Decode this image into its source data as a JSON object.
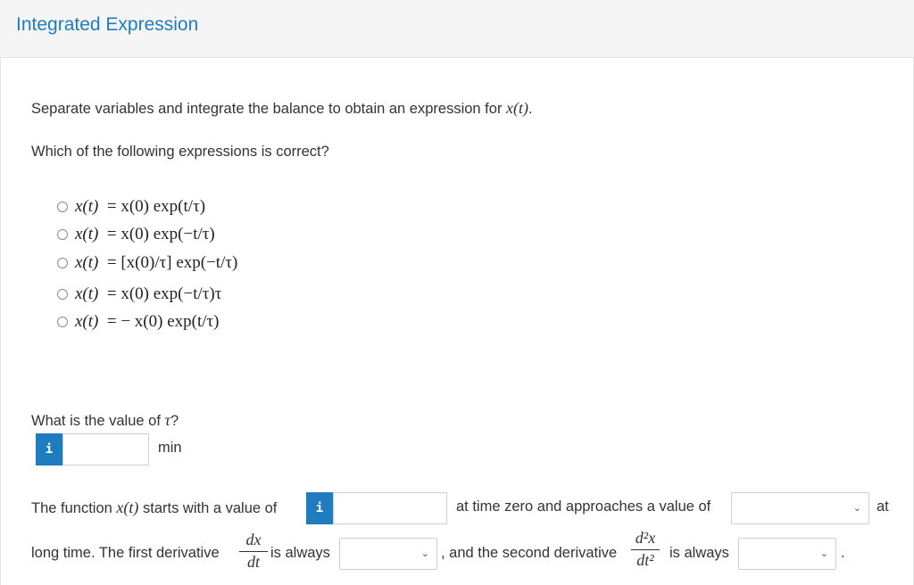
{
  "header": {
    "title": "Integrated Expression"
  },
  "intro": {
    "prefix": "Separate variables and integrate the balance to obtain an expression for",
    "var": "x(t)",
    "suffix": "."
  },
  "question1": {
    "prompt": "Which of the following expressions is correct?",
    "options": [
      {
        "lhs": "x(t)",
        "rhs": "=  x(0) exp(t/τ)"
      },
      {
        "lhs": "x(t)",
        "rhs": "=  x(0) exp(−t/τ)"
      },
      {
        "lhs": "x(t)",
        "rhs": "=  [x(0)/τ]  exp(−t/τ)"
      },
      {
        "lhs": "x(t)",
        "rhs": "=  x(0) exp(−t/τ)τ"
      },
      {
        "lhs": "x(t)",
        "rhs": "=   − x(0) exp(t/τ)"
      }
    ]
  },
  "question2": {
    "prompt_prefix": "What is the value of",
    "symbol": "τ",
    "prompt_suffix": "?",
    "input_value": "",
    "unit": "min",
    "info_label": "i"
  },
  "question3": {
    "text1": "The function",
    "var": "x(t)",
    "text2": "starts with a value of",
    "info_label": "i",
    "start_value": "",
    "text3": "at time zero and approaches a value of",
    "limit_selected": "",
    "text4": "at",
    "text5": "long time. The first derivative",
    "deriv1_num": "dx",
    "deriv1_den": "dt",
    "text6": "is always",
    "deriv1_selected": "",
    "text7": ", and the second derivative",
    "deriv2_num": "d²x",
    "deriv2_den": "dt²",
    "text8": "is always",
    "deriv2_selected": "",
    "text9": "."
  },
  "icons": {
    "radio": "radio-circle",
    "chevron": "chevron-down-icon",
    "info": "info-icon"
  },
  "colors": {
    "accent": "#1f7cbf",
    "header_bg": "#f5f5f5"
  }
}
